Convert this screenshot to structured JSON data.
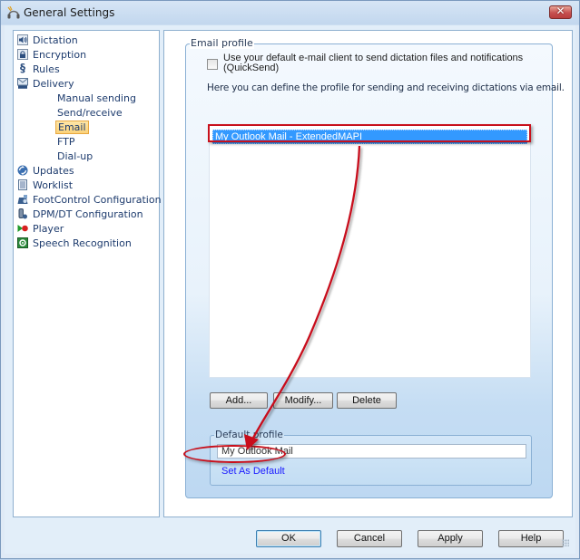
{
  "window": {
    "title": "General Settings",
    "close_label": "✕"
  },
  "sidebar": {
    "items": [
      {
        "label": "Dictation",
        "icon": "speaker-icon",
        "level": 0
      },
      {
        "label": "Encryption",
        "icon": "lock-icon",
        "level": 0
      },
      {
        "label": "Rules",
        "icon": "section-sign-icon",
        "level": 0
      },
      {
        "label": "Delivery",
        "icon": "delivery-ftp-icon",
        "level": 0
      },
      {
        "label": "Manual sending",
        "level": 1
      },
      {
        "label": "Send/receive",
        "level": 1
      },
      {
        "label": "Email",
        "level": 1,
        "selected": true
      },
      {
        "label": "FTP",
        "level": 1
      },
      {
        "label": "Dial-up",
        "level": 1
      },
      {
        "label": "Updates",
        "icon": "updates-globe-icon",
        "level": 0
      },
      {
        "label": "Worklist",
        "icon": "worklist-icon",
        "level": 0
      },
      {
        "label": "FootControl Configuration",
        "icon": "footcontrol-icon",
        "level": 0
      },
      {
        "label": "DPM/DT Configuration",
        "icon": "device-icon",
        "level": 0
      },
      {
        "label": "Player",
        "icon": "player-icon",
        "level": 0
      },
      {
        "label": "Speech Recognition",
        "icon": "speech-recognition-icon",
        "level": 0
      }
    ]
  },
  "email_profile": {
    "legend": "Email profile",
    "quicksend_label": "Use your default e-mail client to send dictation files and notifications (QuickSend)",
    "quicksend_checked": false,
    "hint": "Here you can define the profile for sending and receiving dictations via email.",
    "profiles": [
      "My Outlook Mail - ExtendedMAPI"
    ],
    "selected_profile": "My Outlook Mail - ExtendedMAPI",
    "buttons": {
      "add": "Add...",
      "modify": "Modify...",
      "delete": "Delete"
    },
    "default_profile": {
      "legend": "Default profile",
      "value": "My Outlook Mail",
      "set_default_link": "Set As Default"
    }
  },
  "footer": {
    "ok": "OK",
    "cancel": "Cancel",
    "apply": "Apply",
    "help": "Help"
  },
  "annotation": {
    "color": "#c8101c"
  }
}
